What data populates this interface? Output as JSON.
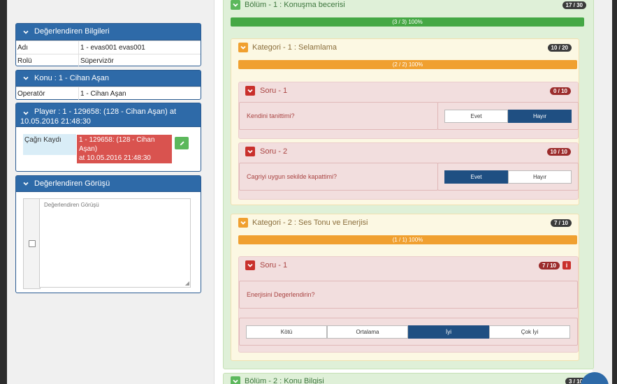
{
  "left": {
    "evaluator_panel": {
      "title": "Değerlendiren Bilgileri",
      "rows": [
        {
          "label": "Adı",
          "value": "1 - evas001 evas001"
        },
        {
          "label": "Rolü",
          "value": "Süpervizör"
        }
      ]
    },
    "topic_panel": {
      "title": "Konu : 1 - Cihan Aşan",
      "rows": [
        {
          "label": "Operatör",
          "value": "1 - Cihan Aşan"
        }
      ]
    },
    "player_panel": {
      "title_line1": "Player : 1 - 129658: (128 - Cihan Aşan) at",
      "title_line2": "10.05.2016 21:48:30",
      "call_label": "Çağrı Kaydı",
      "call_value_line1": "1 - 129658: (128 - Cihan Aşan)",
      "call_value_line2": "at 10.05.2016 21:48:30"
    },
    "opinion_panel": {
      "title": "Değerlendiren Görüşü",
      "placeholder": "Değerlendiren Görüşü"
    }
  },
  "right": {
    "bolum1": {
      "title": "Bölüm - 1 : Konuşma becerisi",
      "score": "17 / 30",
      "progress_text": "(3 / 3) 100%",
      "progress_percent": 100,
      "kategori1": {
        "title": "Kategori - 1 : Selamlama",
        "score": "10 / 20",
        "progress_text": "(2 / 2) 100%",
        "progress_percent": 100,
        "soru1": {
          "title": "Soru - 1",
          "score": "0 / 10",
          "question": "Kendini tanittimi?",
          "options": [
            "Evet",
            "Hayır"
          ],
          "selected": "Hayır"
        },
        "soru2": {
          "title": "Soru - 2",
          "score": "10 / 10",
          "question": "Cagriyi uygun sekilde kapattimi?",
          "options": [
            "Evet",
            "Hayır"
          ],
          "selected": "Evet"
        }
      },
      "kategori2": {
        "title": "Kategori - 2 : Ses Tonu ve Enerjisi",
        "score": "7 / 10",
        "progress_text": "(1 / 1) 100%",
        "progress_percent": 100,
        "soru1": {
          "title": "Soru - 1",
          "score": "7 / 10",
          "info_icon": "i",
          "question": "Enerjisini Degerlendirin?",
          "options": [
            "Kötü",
            "Ortalama",
            "İyi",
            "Çok İyi"
          ],
          "selected": "İyi"
        }
      }
    },
    "bolum2": {
      "title": "Bölüm - 2 : Konu Bilgisi",
      "score": "3 / 10"
    }
  },
  "colors": {
    "panel_header": "#2e6aa8",
    "selected_button": "#1f4f82",
    "section_green": "#dff0d8",
    "category_yellow": "#fcf8e3",
    "question_red": "#f2dede",
    "bar_orange": "#f0a030",
    "bar_green": "#45a845"
  }
}
